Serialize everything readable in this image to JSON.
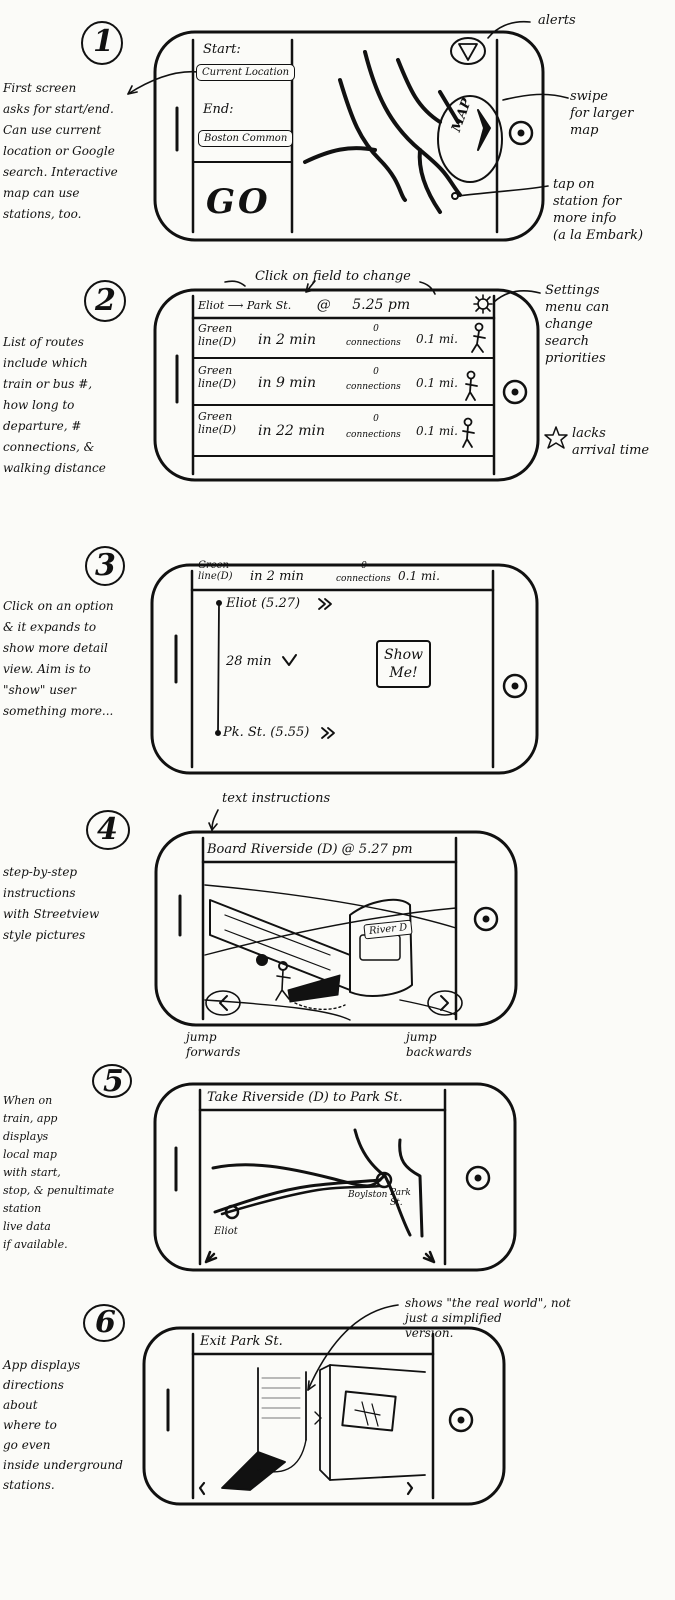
{
  "s1": {
    "num": "1",
    "note": "First screen\nasks for start/end.\nCan use current\nlocation or Google\nsearch. Interactive\nmap can use\nstations, too.",
    "start_label": "Start:",
    "start_value": "Current Location",
    "end_label": "End:",
    "end_value": "Boston Common",
    "go": "GO",
    "map_label": "MAP",
    "alerts_icon": "!",
    "ann_alerts": "alerts",
    "ann_swipe": "swipe\nfor larger\nmap",
    "ann_tap": "tap on\nstation for\nmore info\n(a la Embark)"
  },
  "s2": {
    "num": "2",
    "note": "List of routes\ninclude which\ntrain or bus #,\nhow long to\ndeparture, #\nconnections, &\nwalking distance",
    "header_from": "Eliot",
    "header_to": "Park St.",
    "header_at": "@",
    "header_time": "5.25 pm",
    "ann_click": "Click on field to change",
    "ann_settings": "Settings\nmenu can\nchange\nsearch\npriorities",
    "ann_lacks": "lacks\narrival time",
    "rows": [
      {
        "line1": "Green",
        "line2": "line(D)",
        "time": "in 2 min",
        "conn_num": "0",
        "conn": "connections",
        "dist": "0.1 mi."
      },
      {
        "line1": "Green",
        "line2": "line(D)",
        "time": "in 9 min",
        "conn_num": "0",
        "conn": "connections",
        "dist": "0.1 mi."
      },
      {
        "line1": "Green",
        "line2": "line(D)",
        "time": "in 22 min",
        "conn_num": "0",
        "conn": "connections",
        "dist": "0.1 mi."
      }
    ]
  },
  "s3": {
    "num": "3",
    "note": "Click on an option\n& it expands to\nshow more detail\nview. Aim is to\n\"show\" user\nsomething more...",
    "header_line1": "Green",
    "header_line2": "line(D)",
    "header_time": "in 2 min",
    "header_conn_num": "0",
    "header_conn": "connections",
    "header_dist": "0.1 mi.",
    "stop1": "Eliot (5.27)",
    "duration": "28 min",
    "stop2": "Pk. St. (5.55)",
    "show_me": "Show\nMe!"
  },
  "s4": {
    "num": "4",
    "note": "step-by-step\ninstructions\nwith Streetview\nstyle pictures",
    "ann_text": "text instructions",
    "instruction": "Board Riverside (D) @ 5.27 pm",
    "train_sign": "River D",
    "ann_forward": "jump\nforwards",
    "ann_backward": "jump\nbackwards"
  },
  "s5": {
    "num": "5",
    "note": "When on\ntrain, app\ndisplays\nlocal map\nwith start,\nstop, & penultimate\nstation\nlive data\nif available.",
    "instruction": "Take Riverside (D) to Park St.",
    "label_start": "Eliot",
    "label_mid": "Boylston",
    "label_end": "Park\nSt."
  },
  "s6": {
    "num": "6",
    "note": "App displays\ndirections\nabout\nwhere to\ngo even\ninside underground\nstations.",
    "instruction": "Exit Park St.",
    "ann_shows": "shows \"the real world\", not\njust a simplified\nversion."
  }
}
